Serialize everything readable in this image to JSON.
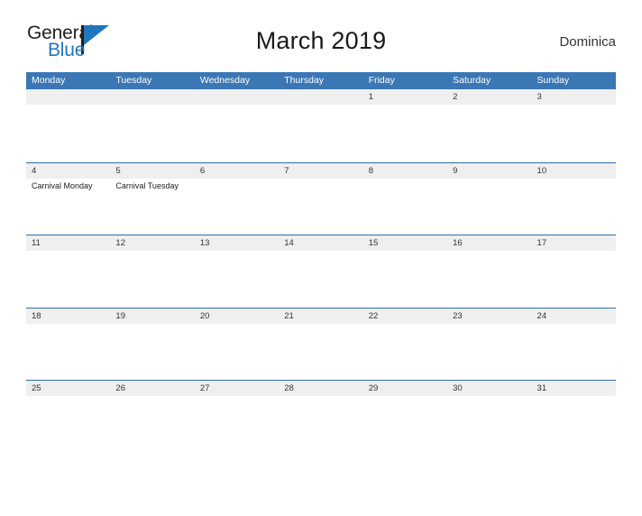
{
  "brand": {
    "name_part1": "General",
    "name_part2": "Blue",
    "flag_color": "#1f76bc",
    "text_color": "#231f20"
  },
  "header": {
    "title": "March 2019",
    "region": "Dominica"
  },
  "colors": {
    "header_blue": "#3b77b4",
    "row_divider": "#2f6ea5",
    "date_band": "#efefef",
    "page_background": "#ffffff"
  },
  "calendar": {
    "weekdays": [
      "Monday",
      "Tuesday",
      "Wednesday",
      "Thursday",
      "Friday",
      "Saturday",
      "Sunday"
    ],
    "weeks": [
      {
        "days": [
          {
            "num": "",
            "events": []
          },
          {
            "num": "",
            "events": []
          },
          {
            "num": "",
            "events": []
          },
          {
            "num": "",
            "events": []
          },
          {
            "num": "1",
            "events": []
          },
          {
            "num": "2",
            "events": []
          },
          {
            "num": "3",
            "events": []
          }
        ]
      },
      {
        "days": [
          {
            "num": "4",
            "events": [
              "Carnival Monday"
            ]
          },
          {
            "num": "5",
            "events": [
              "Carnival Tuesday"
            ]
          },
          {
            "num": "6",
            "events": []
          },
          {
            "num": "7",
            "events": []
          },
          {
            "num": "8",
            "events": []
          },
          {
            "num": "9",
            "events": []
          },
          {
            "num": "10",
            "events": []
          }
        ]
      },
      {
        "days": [
          {
            "num": "11",
            "events": []
          },
          {
            "num": "12",
            "events": []
          },
          {
            "num": "13",
            "events": []
          },
          {
            "num": "14",
            "events": []
          },
          {
            "num": "15",
            "events": []
          },
          {
            "num": "16",
            "events": []
          },
          {
            "num": "17",
            "events": []
          }
        ]
      },
      {
        "days": [
          {
            "num": "18",
            "events": []
          },
          {
            "num": "19",
            "events": []
          },
          {
            "num": "20",
            "events": []
          },
          {
            "num": "21",
            "events": []
          },
          {
            "num": "22",
            "events": []
          },
          {
            "num": "23",
            "events": []
          },
          {
            "num": "24",
            "events": []
          }
        ]
      },
      {
        "days": [
          {
            "num": "25",
            "events": []
          },
          {
            "num": "26",
            "events": []
          },
          {
            "num": "27",
            "events": []
          },
          {
            "num": "28",
            "events": []
          },
          {
            "num": "29",
            "events": []
          },
          {
            "num": "30",
            "events": []
          },
          {
            "num": "31",
            "events": []
          }
        ]
      }
    ]
  }
}
